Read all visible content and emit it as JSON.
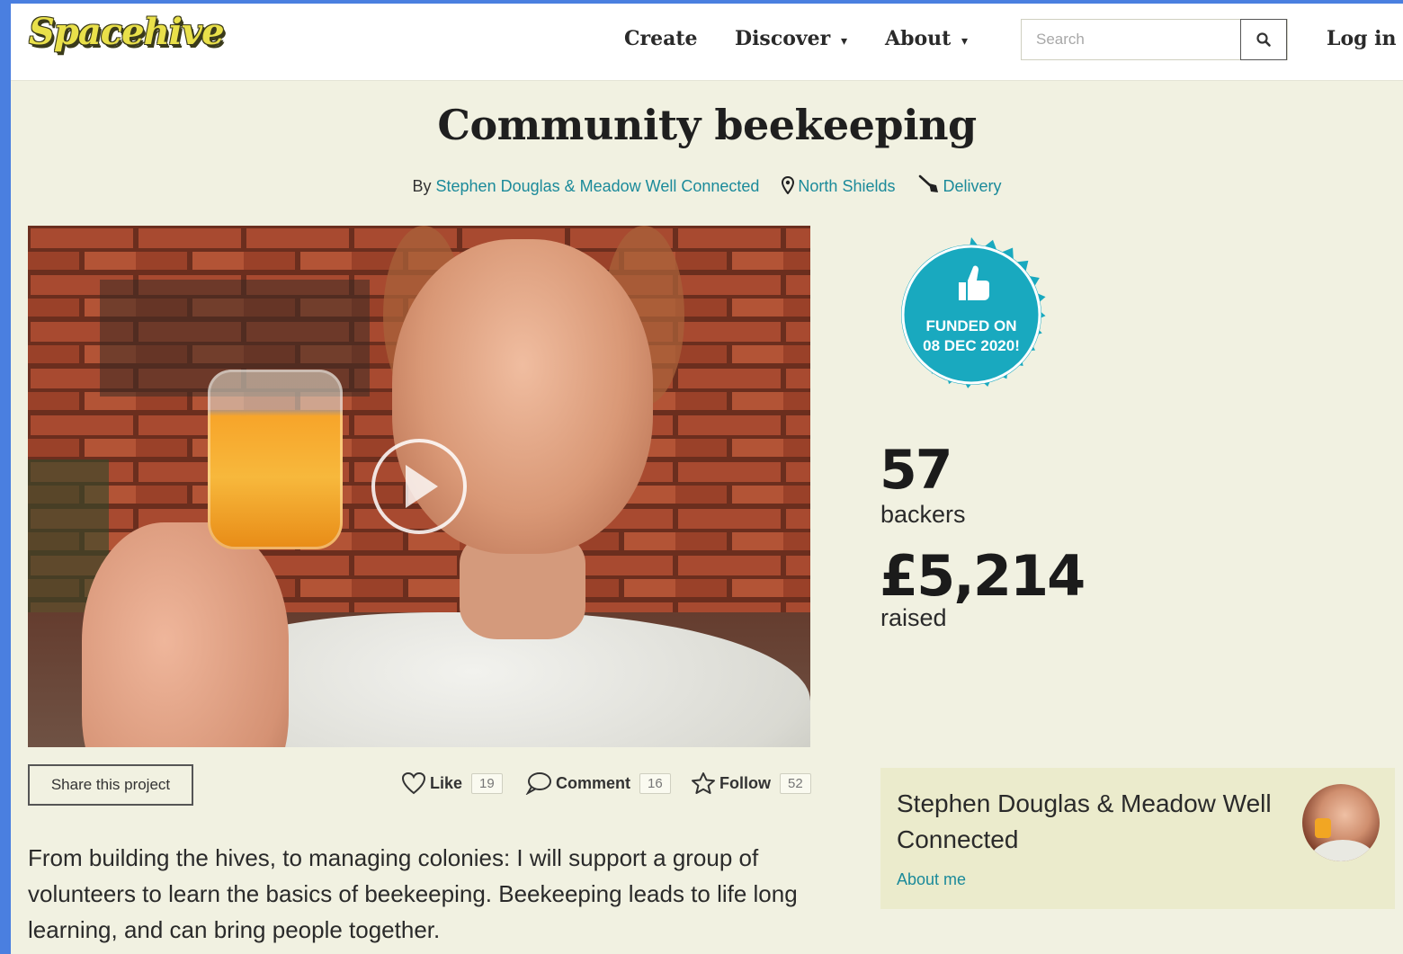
{
  "header": {
    "logo_text": "Spacehive",
    "nav": {
      "create": "Create",
      "discover": "Discover",
      "about": "About",
      "caret": "▾"
    },
    "search": {
      "placeholder": "Search",
      "value": ""
    },
    "login": "Log in"
  },
  "project": {
    "title": "Community beekeeping",
    "by_prefix": "By",
    "creator": "Stephen Douglas & Meadow Well Connected",
    "location": "North Shields",
    "stage": "Delivery"
  },
  "badge": {
    "line1": "FUNDED ON",
    "line2": "08 DEC 2020!",
    "color": "#19a9bf"
  },
  "stats": {
    "backers_value": "57",
    "backers_label": "backers",
    "raised_value": "£5,214",
    "raised_label": "raised"
  },
  "actions": {
    "share": "Share this project",
    "like_label": "Like",
    "like_count": "19",
    "comment_label": "Comment",
    "comment_count": "16",
    "follow_label": "Follow",
    "follow_count": "52"
  },
  "description": "From building the hives, to managing colonies: I will support a group of volunteers to learn the basics of beekeeping. Beekeeping leads to life long learning, and can bring people together.",
  "creator_card": {
    "name": "Stephen Douglas & Meadow Well Connected",
    "about_link": "About me"
  },
  "icons": {
    "search": "search-icon",
    "location": "map-pin-icon",
    "stage": "shovel-icon",
    "like": "heart-icon",
    "comment": "speech-bubble-icon",
    "follow": "star-icon",
    "play": "play-icon",
    "thumbs_up": "thumbs-up-icon"
  },
  "colors": {
    "accent_link": "#1b8a9a",
    "page_bg": "#f1f1e1",
    "card_bg": "#ebebcc",
    "logo_yellow": "#e9e04a"
  }
}
